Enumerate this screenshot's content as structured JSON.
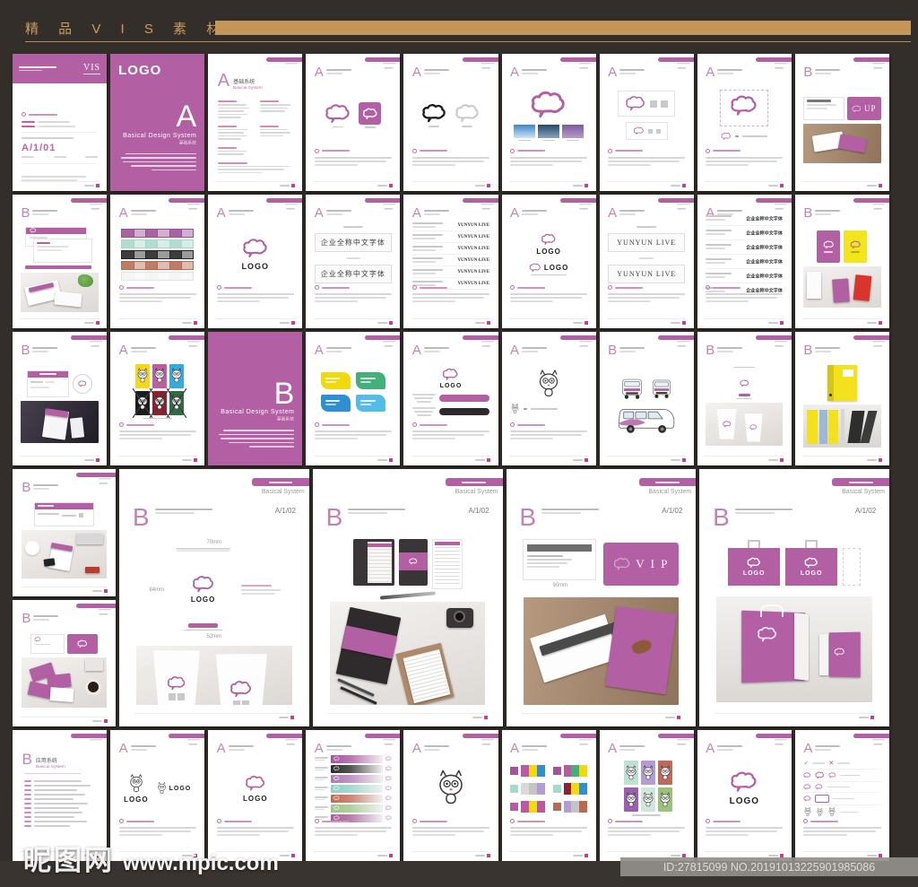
{
  "header": {
    "title": "精 品 V I S 素 材 模 板"
  },
  "watermark": {
    "site_cn": "昵图网",
    "site_url": "www.nipic.com"
  },
  "credits": {
    "id_text": "ID:27815099 NO.20191013225901985086"
  },
  "palette": {
    "accent": "#b25fa3",
    "accent_deep": "#c2418f",
    "gold": "#c49659",
    "bg": "#332e2a",
    "ink": "#1d1d1d",
    "yellow": "#f3e11c",
    "red": "#d8352c",
    "blue": "#35aade"
  },
  "labels": {
    "logo": "LOGO",
    "vis": "VIS",
    "basical_system": "Basical System",
    "code_cover": "A/1/01",
    "code_inner": "A/1/02"
  },
  "pages": [
    {
      "row": 1,
      "kind": "cover",
      "vis": "VIS",
      "code": "A/1/01"
    },
    {
      "row": 1,
      "kind": "purple_cover",
      "letter": "A",
      "logo": "LOGO",
      "title": "Basical Design System",
      "subtitle": "基础系统"
    },
    {
      "row": 1,
      "kind": "toc",
      "letter": "A",
      "title_cn": "基础系统",
      "title_en": "Basical System"
    },
    {
      "row": 1,
      "kind": "logo_pair",
      "letter": "A"
    },
    {
      "row": 1,
      "kind": "logo_bw",
      "letter": "A"
    },
    {
      "row": 1,
      "kind": "logo_photos",
      "letter": "A"
    },
    {
      "row": 1,
      "kind": "logo_spec_box",
      "letter": "A"
    },
    {
      "row": 1,
      "kind": "logo_measure",
      "letter": "A"
    },
    {
      "row": 1,
      "kind": "cards_up",
      "letter": "B",
      "card_label": "UP",
      "desc": false
    },
    {
      "row": 2,
      "kind": "envelopes",
      "letter": "B",
      "desc": false
    },
    {
      "row": 2,
      "kind": "color_table",
      "letter": "A",
      "rows": [
        "#9c4f93",
        "#a5d9c9",
        "#232323",
        "#b96a50",
        "#f4f4f4"
      ]
    },
    {
      "row": 2,
      "kind": "cloud_logo_stack",
      "letter": "A",
      "logo": "LOGO",
      "size": 30,
      "fs": 9
    },
    {
      "row": 2,
      "kind": "font_cn",
      "letter": "A",
      "specimen": "企业全称中文字体",
      "serif": true
    },
    {
      "row": 2,
      "kind": "font_list",
      "letter": "A",
      "right_label": "YUNYUN LIVE",
      "serif": true
    },
    {
      "row": 2,
      "kind": "logo_combo2",
      "letter": "A",
      "logo": "LOGO"
    },
    {
      "row": 2,
      "kind": "font_cn",
      "letter": "A",
      "specimen": "YUNYUN LIVE",
      "serif": true
    },
    {
      "row": 2,
      "kind": "font_list",
      "letter": "A",
      "right_label": "企业全称中文字体",
      "serif": true
    },
    {
      "row": 2,
      "kind": "cards_yellow",
      "letter": "B",
      "cards": [
        "#b25fa3",
        "#f3e51c"
      ],
      "photo_cards": [
        "#b25fa3",
        "#d8352c"
      ],
      "desc": false
    },
    {
      "row": 3,
      "kind": "badge_photo",
      "letter": "B",
      "desc": false
    },
    {
      "row": 3,
      "kind": "mascot_grid",
      "letter": "A",
      "tiles": [
        "#f3d918",
        "#bb5f9e",
        "#35aade",
        "#1c1c1c",
        "#8e2130",
        "#2f6b45"
      ],
      "crossed": [
        3,
        4,
        5
      ]
    },
    {
      "row": 3,
      "kind": "purple_cover",
      "letter": "B",
      "title": "Basical Design System",
      "subtitle": "基础系统"
    },
    {
      "row": 3,
      "kind": "shapes",
      "letter": "A",
      "tiles": [
        "#f0d90c",
        "#43b07c",
        "#2f8fd0",
        "#55bce8"
      ]
    },
    {
      "row": 3,
      "kind": "logo_bars",
      "letter": "A",
      "logo": "LOGO",
      "bars": [
        "#b25fa3",
        "#2e2a2b"
      ]
    },
    {
      "row": 3,
      "kind": "mascot_single",
      "letter": "A"
    },
    {
      "row": 3,
      "kind": "vehicles",
      "letter": "B",
      "desc": false
    },
    {
      "row": 3,
      "kind": "cup_diagram",
      "letter": "B",
      "desc": false
    },
    {
      "row": 3,
      "kind": "folder_yellow",
      "letter": "B",
      "folder_color": "#f3e11c",
      "desc": false
    },
    {
      "row": 4,
      "stack": true,
      "kind": "badge_photo2",
      "letter": "B",
      "desc": false
    },
    {
      "row": 4,
      "stack": true,
      "kind": "cards_photo2",
      "letter": "B",
      "desc": false
    },
    {
      "row": 4,
      "kind": "cup_large",
      "letter": "B",
      "large": true,
      "code": "A/1/02",
      "tab_sub": "Basical System",
      "logo": "LOGO",
      "dim_top": "70mm",
      "dim_h": "84mm",
      "dim_b": "52mm",
      "desc": false
    },
    {
      "row": 4,
      "kind": "notebook",
      "letter": "B",
      "large": true,
      "code": "A/1/02",
      "tab_sub": "Basical System",
      "desc": false
    },
    {
      "row": 4,
      "kind": "vip_cards",
      "letter": "B",
      "large": true,
      "code": "A/1/02",
      "tab_sub": "Basical System",
      "vip": "V I P",
      "width_label": "90mm",
      "desc": false
    },
    {
      "row": 4,
      "kind": "bags",
      "letter": "B",
      "large": true,
      "code": "A/1/02",
      "tab_sub": "Basical System",
      "logo": "LOGO",
      "desc": false
    },
    {
      "row": 5,
      "kind": "toc_b",
      "letter": "B",
      "title_cn": "应用系统",
      "title_en": "Basical System"
    },
    {
      "row": 5,
      "kind": "mascot_logo",
      "letter": "A",
      "logo": "LOGO"
    },
    {
      "row": 5,
      "kind": "cloud_logo_stack",
      "letter": "A",
      "logo": "LOGO",
      "size": 24,
      "fs": 8
    },
    {
      "row": 5,
      "kind": "color_gradients",
      "letter": "A",
      "rows": [
        "#a8519c",
        "#2b2b2b",
        "#b07ab5",
        "#8fd0c3",
        "#bf6a52",
        "#9fc487",
        "#a75f93"
      ]
    },
    {
      "row": 5,
      "kind": "mascot_big",
      "letter": "A"
    },
    {
      "row": 5,
      "kind": "color_combos",
      "letter": "A",
      "groups": [
        {
          "sq": "#a8519c",
          "bar": [
            "#bb58a4",
            "#f0d90c",
            "#2f8fd0"
          ]
        },
        {
          "sq": "#a8519c",
          "bar": [
            "#bb58a4",
            "#43b07c",
            "#f0d90c"
          ]
        },
        {
          "sq": "#a5d9c9",
          "bar": [
            "#d9d9d9",
            "#c4c4c4",
            "#b49bd1"
          ]
        },
        {
          "sq": "#a5d9c9",
          "bar": [
            "#8e2130",
            "#f0d90c",
            "#2f8fd0"
          ]
        },
        {
          "sq": "#bb58a4",
          "bar": [
            "#bb58a4",
            "#f0d90c",
            "#bb58a4"
          ]
        },
        {
          "sq": "#b96a50",
          "bar": [
            "#b49bd1",
            "#c4c4c4",
            "#b96a50"
          ]
        }
      ]
    },
    {
      "row": 5,
      "kind": "mascot_grid",
      "letter": "A",
      "tiles": [
        "#bfe0d2",
        "#b49bd1",
        "#bc6a5a",
        "#9a5fae",
        "#cfe6dc",
        "#9cc27a"
      ],
      "crossed": []
    },
    {
      "row": 5,
      "kind": "cloud_logo_stack",
      "letter": "A",
      "logo": "LOGO",
      "size": 32,
      "fs": 10
    },
    {
      "row": 5,
      "kind": "logo_spec_rows",
      "letter": "A"
    }
  ]
}
